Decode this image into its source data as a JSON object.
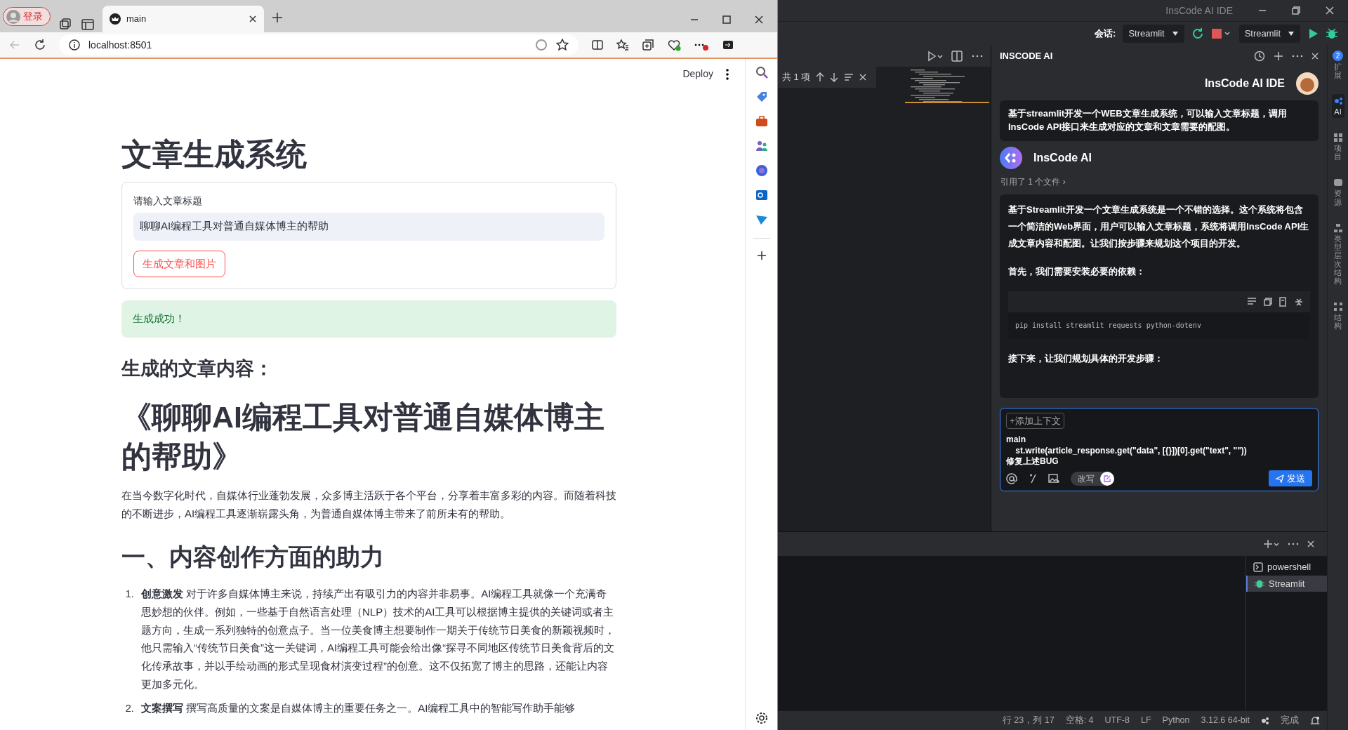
{
  "browser": {
    "profile_button": "登录",
    "tab": {
      "title": "main",
      "selected": true
    },
    "address": "localhost:8501"
  },
  "streamlit": {
    "deploy": "Deploy",
    "title": "文章生成系统",
    "input_label": "请输入文章标题",
    "input_value": "聊聊AI编程工具对普通自媒体博主的帮助",
    "generate_button": "生成文章和图片",
    "success": "生成成功！",
    "section_heading": "生成的文章内容：",
    "article_title": "《聊聊AI编程工具对普通自媒体博主的帮助》",
    "intro": "在当今数字化时代，自媒体行业蓬勃发展，众多博主活跃于各个平台，分享着丰富多彩的内容。而随着科技的不断进步，AI编程工具逐渐崭露头角，为普通自媒体博主带来了前所未有的帮助。",
    "h2": "一、内容创作方面的助力",
    "list": [
      {
        "number": "1.",
        "term": "创意激发",
        "text": "对于许多自媒体博主来说，持续产出有吸引力的内容并非易事。AI编程工具就像一个充满奇思妙想的伙伴。例如，一些基于自然语言处理（NLP）技术的AI工具可以根据博主提供的关键词或者主题方向，生成一系列独特的创意点子。当一位美食博主想要制作一期关于传统节日美食的新颖视频时，他只需输入“传统节日美食”这一关键词，AI编程工具可能会给出像“探寻不同地区传统节日美食背后的文化传承故事，并以手绘动画的形式呈现食材演变过程”的创意。这不仅拓宽了博主的思路，还能让内容更加多元化。"
      },
      {
        "number": "2.",
        "term": "文案撰写",
        "text": "撰写高质量的文案是自媒体博主的重要任务之一。AI编程工具中的智能写作助手能够"
      }
    ]
  },
  "ide": {
    "title": "InsCode AI IDE",
    "session_label": "会话:",
    "session": "Streamlit",
    "run_config": "Streamlit",
    "find_count": "共 1 项",
    "panel_title": "INSCODE AI",
    "chat": {
      "user_name": "InsCode AI IDE",
      "user_message": "基于streamlit开发一个WEB文章生成系统，可以输入文章标题，调用InsCode API接口来生成对应的文章和文章需要的配图。",
      "ai_name": "InsCode AI",
      "reference": "引用了 1 个文件 ›",
      "blocks": [
        {
          "kind": "text",
          "text": "基于Streamlit开发一个文章生成系统是一个不错的选择。这个系统将包含一个简洁的Web界面，用户可以输入文章标题，系统将调用InsCode API生成文章内容和配图。让我们按步骤来规划这个项目的开发。"
        },
        {
          "kind": "text",
          "text": "首先，我们需要安装必要的依赖："
        },
        {
          "kind": "code",
          "text": "pip install streamlit requests python-dotenv"
        },
        {
          "kind": "text",
          "text": "接下来，让我们规划具体的开发步骤："
        }
      ]
    },
    "composer": {
      "add_context": "+添加上下文",
      "lines": [
        "main",
        "    st.write(article_response.get(\"data\", [{}])[0].get(\"text\", \"\"))",
        "修复上述BUG"
      ],
      "rewrite": "改写",
      "send": "发送"
    },
    "terminals": [
      {
        "name": "powershell",
        "kind": "shell",
        "selected": false
      },
      {
        "name": "Streamlit",
        "kind": "debug",
        "selected": true
      }
    ],
    "activity": [
      {
        "label": "扩展",
        "badge": "2",
        "selected": false
      },
      {
        "label": "AI",
        "selected": true
      },
      {
        "label": "项目",
        "selected": false
      },
      {
        "label": "资源",
        "selected": false
      },
      {
        "label": "类型层次结构",
        "selected": false
      },
      {
        "label": "结构",
        "selected": false
      }
    ],
    "status_bar": [
      "行 23，列 17",
      "空格: 4",
      "UTF-8",
      "LF",
      "Python",
      "3.12.6 64-bit",
      "完成"
    ]
  }
}
